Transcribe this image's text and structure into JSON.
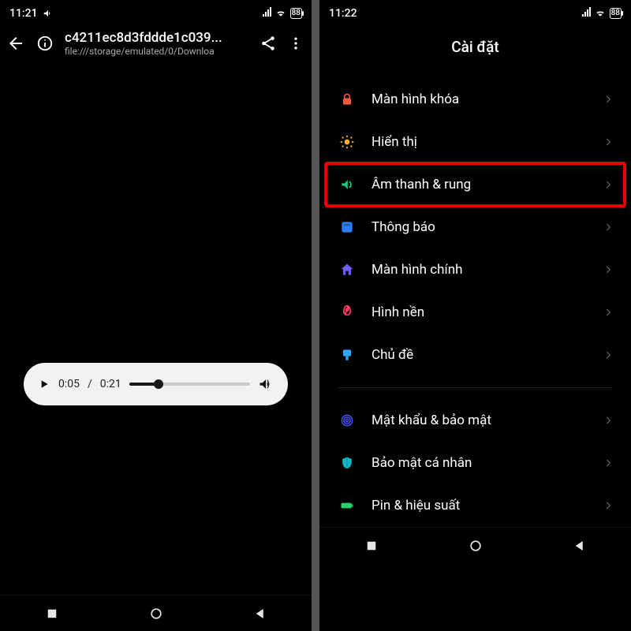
{
  "left": {
    "status": {
      "time": "11:21",
      "battery": "88"
    },
    "browser": {
      "title": "c4211ec8d3fddde1c039...",
      "subtitle": "file:///storage/emulated/0/Downloa"
    },
    "audio": {
      "current": "0:05",
      "total": "0:21",
      "progress_pct": 24
    }
  },
  "right": {
    "status": {
      "time": "11:22",
      "battery": "88"
    },
    "title": "Cài đặt",
    "items": [
      {
        "label": "Màn hình khóa",
        "icon": "lock",
        "color": "#f05a3c",
        "highlight": false
      },
      {
        "label": "Hiển thị",
        "icon": "sun",
        "color": "#ffb327",
        "highlight": false
      },
      {
        "label": "Âm thanh & rung",
        "icon": "sound",
        "color": "#18c978",
        "highlight": true
      },
      {
        "label": "Thông báo",
        "icon": "notification",
        "color": "#2f7dff",
        "highlight": false
      },
      {
        "label": "Màn hình chính",
        "icon": "home",
        "color": "#6a5cff",
        "highlight": false
      },
      {
        "label": "Hình nền",
        "icon": "wallpaper",
        "color": "#ff3f62",
        "highlight": false
      },
      {
        "label": "Chủ đề",
        "icon": "theme",
        "color": "#2fa8ff",
        "highlight": false
      }
    ],
    "items2": [
      {
        "label": "Mật khẩu & bảo mật",
        "icon": "fingerprint",
        "color": "#4a4cff"
      },
      {
        "label": "Bảo mật cá nhân",
        "icon": "shield",
        "color": "#16b6c9"
      },
      {
        "label": "Pin & hiệu suất",
        "icon": "battery",
        "color": "#22d36b"
      }
    ]
  }
}
